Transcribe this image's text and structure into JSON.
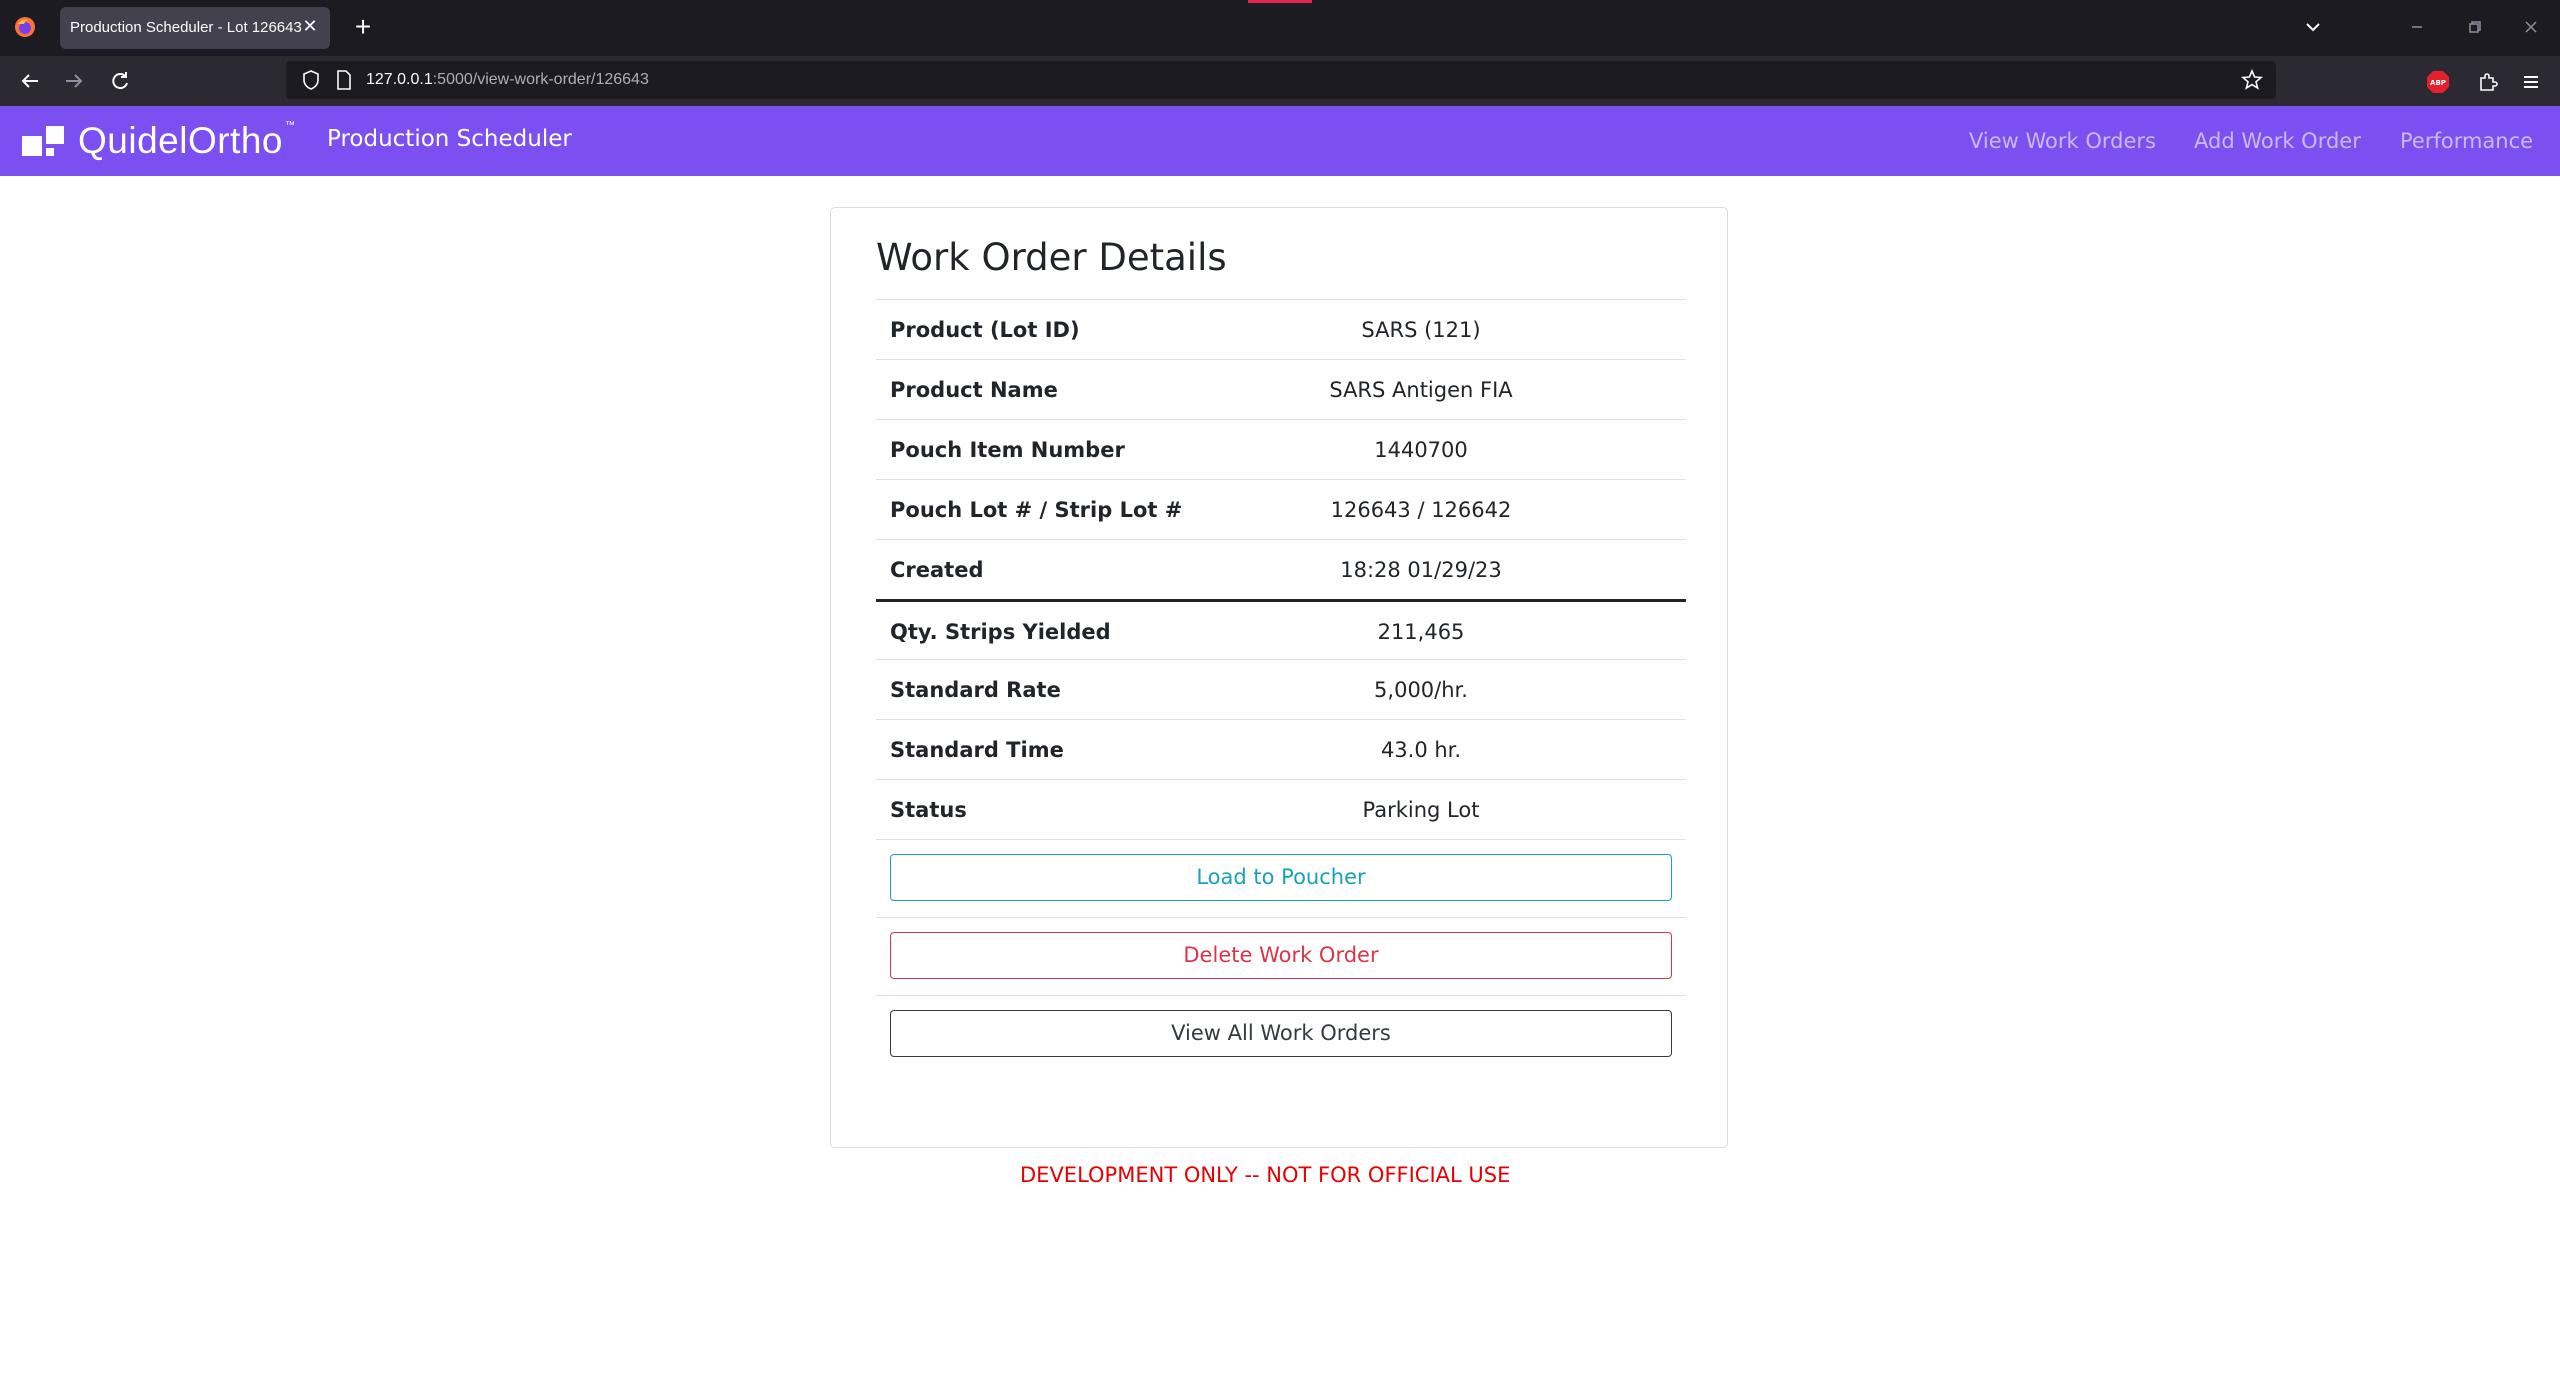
{
  "browser": {
    "tab_title": "Production Scheduler - Lot 126643",
    "url_host": "127.0.0.1",
    "url_path": ":5000/view-work-order/126643"
  },
  "header": {
    "brand": "QuidelOrtho",
    "brand_tm": "™",
    "app_title": "Production Scheduler",
    "nav": {
      "view_work_orders": "View Work Orders",
      "add_work_order": "Add Work Order",
      "performance": "Performance"
    },
    "color": "#7b4ff0"
  },
  "card": {
    "title": "Work Order Details",
    "rows": [
      {
        "label": "Product (Lot ID)",
        "value": "SARS (121)"
      },
      {
        "label": "Product Name",
        "value": "SARS Antigen FIA"
      },
      {
        "label": "Pouch Item Number",
        "value": "1440700"
      },
      {
        "label": "Pouch Lot # / Strip Lot #",
        "value": "126643 / 126642"
      },
      {
        "label": "Created",
        "value": "18:28 01/29/23"
      },
      {
        "label": "Qty. Strips Yielded",
        "value": "211,465"
      },
      {
        "label": "Standard Rate",
        "value": "5,000/hr."
      },
      {
        "label": "Standard Time",
        "value": "43.0 hr."
      },
      {
        "label": "Status",
        "value": "Parking Lot"
      }
    ],
    "buttons": {
      "load": "Load to Poucher",
      "delete": "Delete Work Order",
      "view_all": "View All Work Orders"
    }
  },
  "footer_note": "DEVELOPMENT ONLY -- NOT FOR OFFICIAL USE"
}
